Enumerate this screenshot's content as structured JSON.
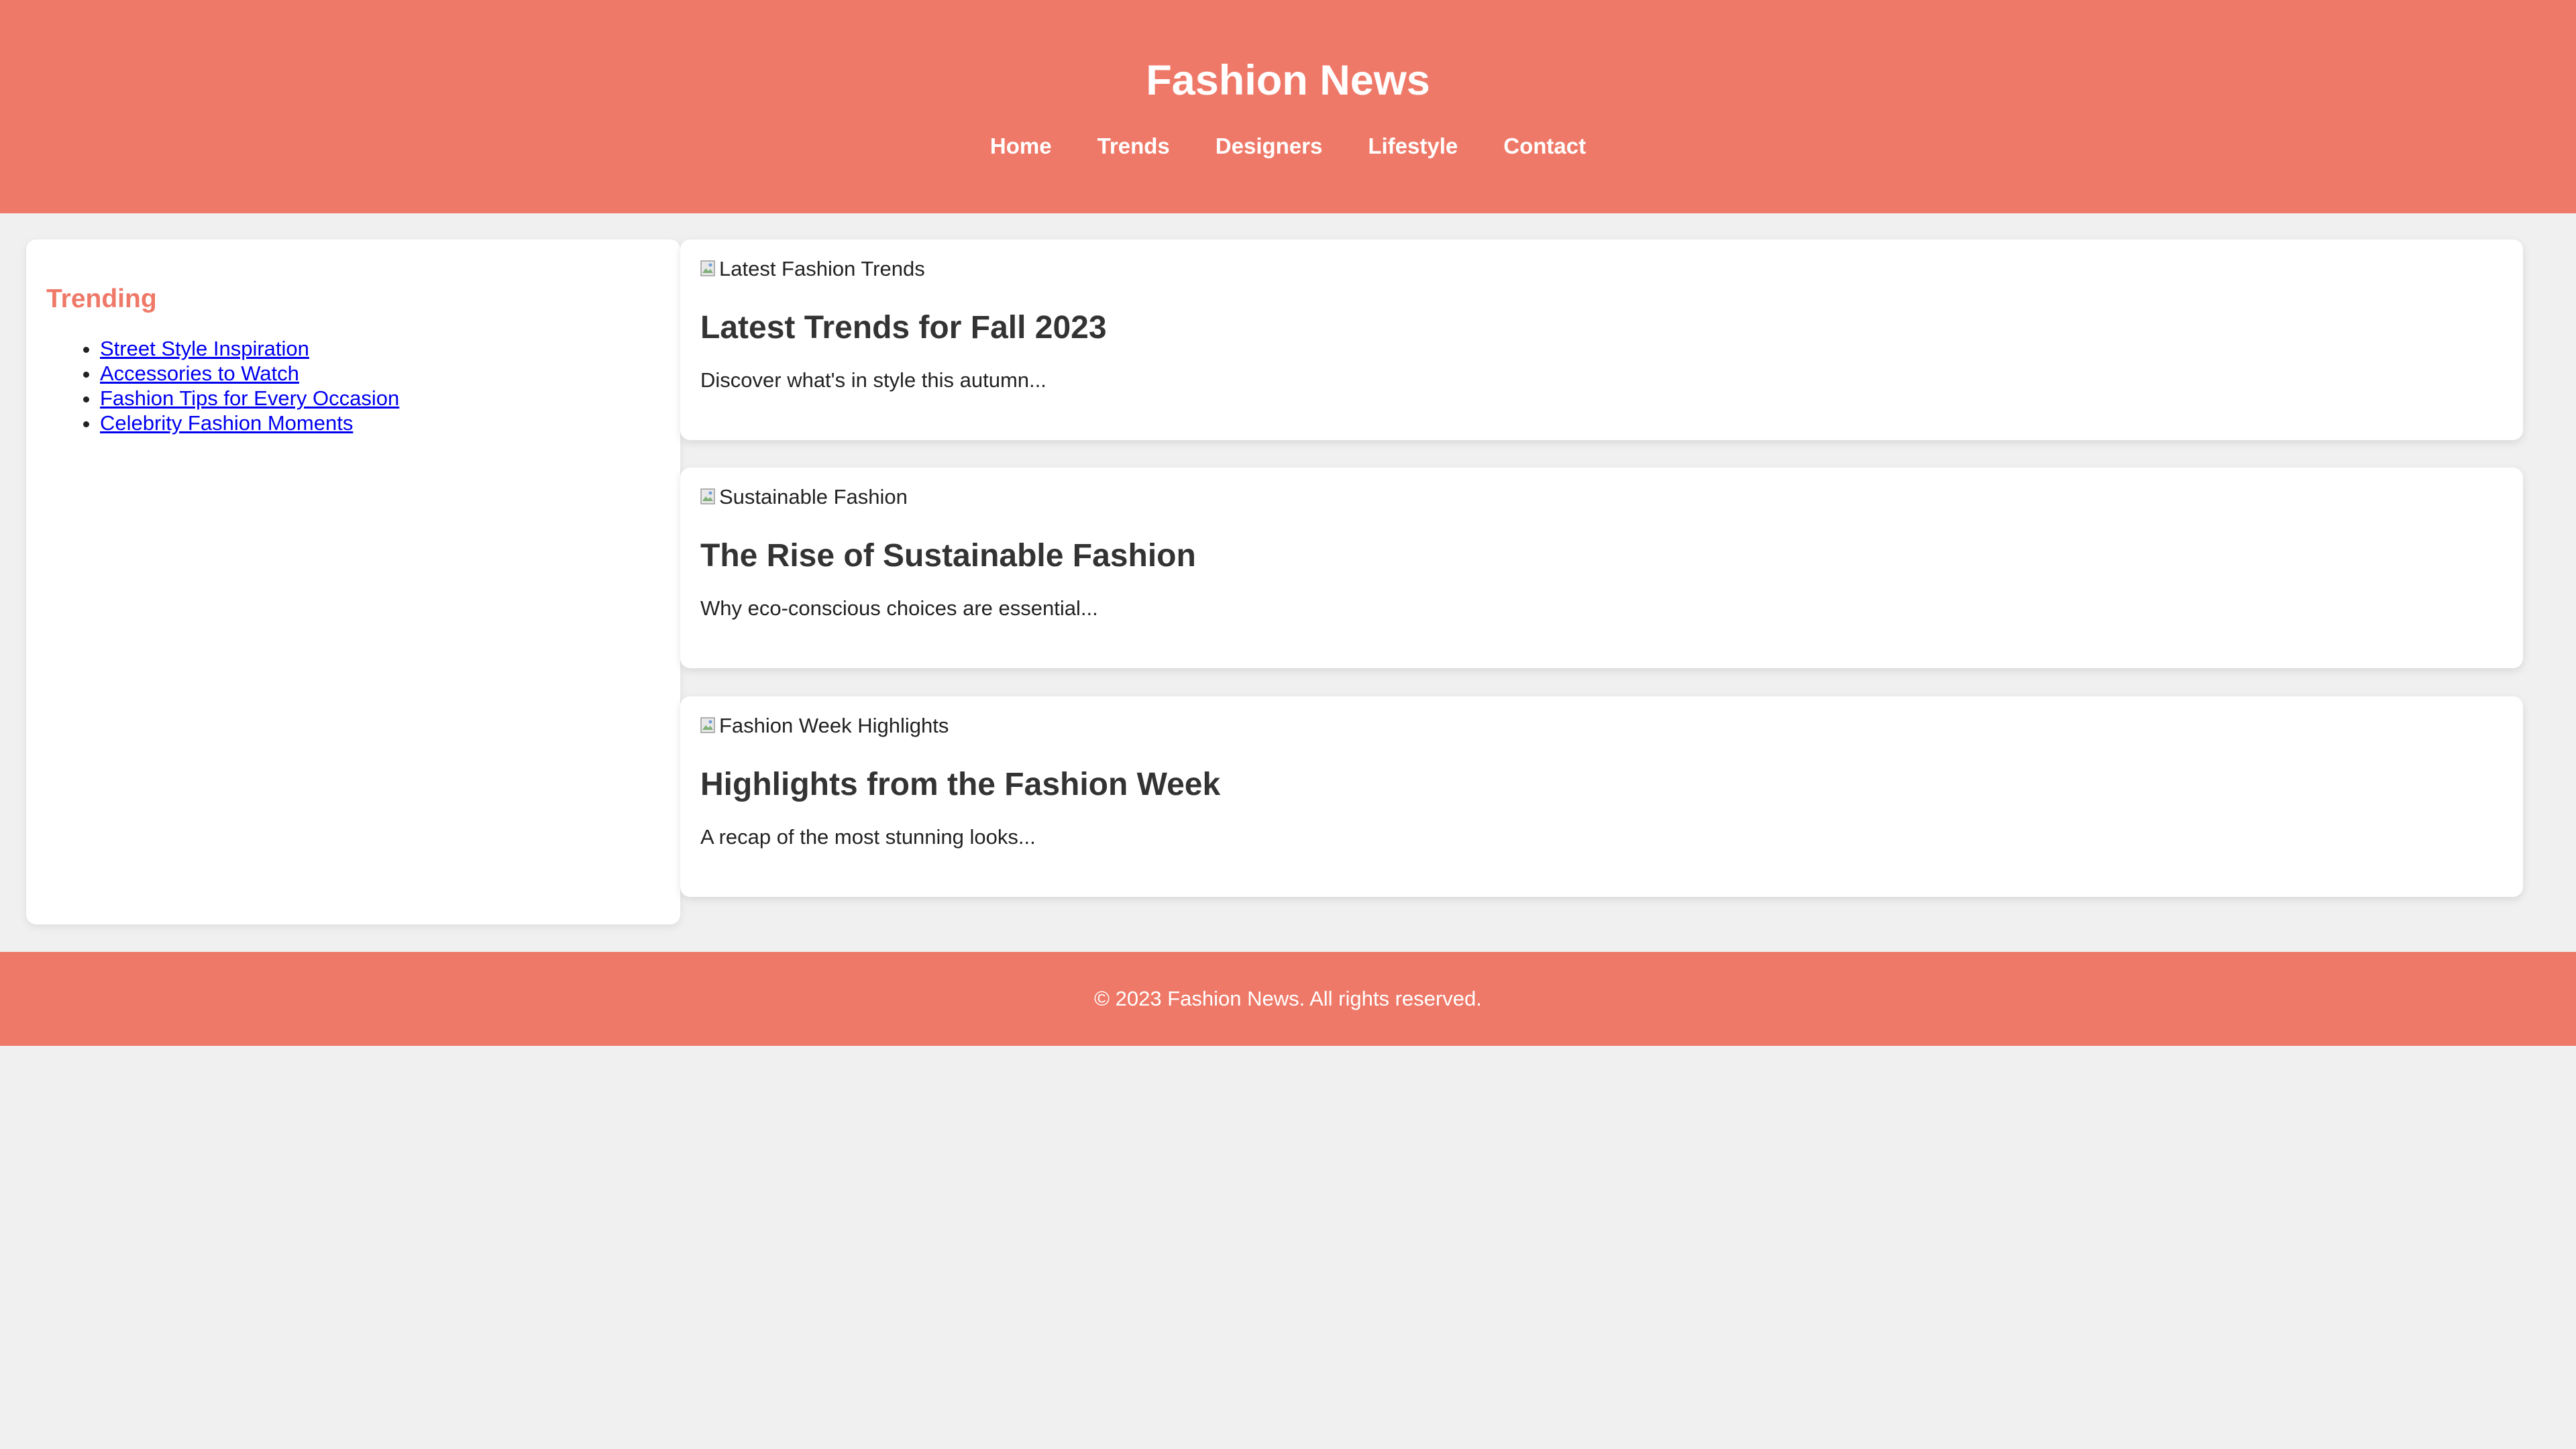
{
  "header": {
    "title": "Fashion News",
    "nav": [
      "Home",
      "Trends",
      "Designers",
      "Lifestyle",
      "Contact"
    ]
  },
  "sidebar": {
    "title": "Trending",
    "items": [
      "Street Style Inspiration",
      "Accessories to Watch",
      "Fashion Tips for Every Occasion",
      "Celebrity Fashion Moments"
    ]
  },
  "articles": [
    {
      "image_alt": "Latest Fashion Trends",
      "title": "Latest Trends for Fall 2023",
      "description": "Discover what's in style this autumn..."
    },
    {
      "image_alt": "Sustainable Fashion",
      "title": "The Rise of Sustainable Fashion",
      "description": "Why eco-conscious choices are essential..."
    },
    {
      "image_alt": "Fashion Week Highlights",
      "title": "Highlights from the Fashion Week",
      "description": "A recap of the most stunning looks..."
    }
  ],
  "footer": {
    "text": "© 2023 Fashion News. All rights reserved."
  },
  "colors": {
    "brand": "#ef7968",
    "background": "#f0f0f0",
    "card": "#ffffff",
    "link": "#0000ee"
  },
  "icons": {
    "broken_image": "broken-image-icon"
  }
}
